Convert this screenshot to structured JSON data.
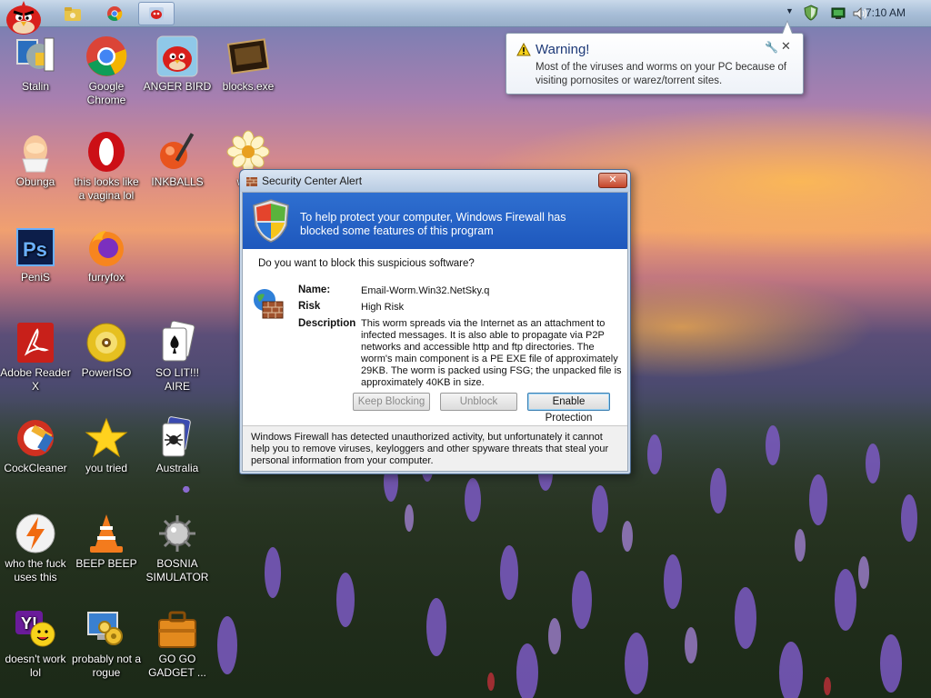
{
  "taskbar": {
    "clock": "7:10 AM"
  },
  "desktop_icons": [
    {
      "label": "Stalin",
      "icon": "stalin-icon"
    },
    {
      "label": "Google Chrome",
      "icon": "chrome-icon"
    },
    {
      "label": "ANGER BIRD",
      "icon": "angry-bird-icon"
    },
    {
      "label": "blocks.exe",
      "icon": "blocks-icon"
    },
    {
      "label": "Obunga",
      "icon": "egg-icon"
    },
    {
      "label": "this looks like a vagina lol",
      "icon": "opera-icon"
    },
    {
      "label": "INKBALLS",
      "icon": "inkballs-icon"
    },
    {
      "label": "winn",
      "icon": "flower-icon"
    },
    {
      "label": "PeniS",
      "icon": "photoshop-icon"
    },
    {
      "label": "furryfox",
      "icon": "firefox-icon"
    },
    {
      "label": "Adobe Reader X",
      "icon": "adobe-reader-icon"
    },
    {
      "label": "PowerISO",
      "icon": "poweriso-icon"
    },
    {
      "label": "SO LIT!!! AIRE",
      "icon": "solitaire-icon"
    },
    {
      "label": "CockCleaner",
      "icon": "ccleaner-icon"
    },
    {
      "label": "you tried",
      "icon": "star-icon"
    },
    {
      "label": "Australia",
      "icon": "spider-solitaire-icon"
    },
    {
      "label": "who the fuck uses this",
      "icon": "winamp-icon"
    },
    {
      "label": "BEEP BEEP",
      "icon": "vlc-icon"
    },
    {
      "label": "BOSNIA SIMULATOR",
      "icon": "minesweeper-icon"
    },
    {
      "label": "doesn't work lol",
      "icon": "yahoo-messenger-icon"
    },
    {
      "label": "probably not a rogue",
      "icon": "pc-gears-icon"
    },
    {
      "label": "GO GO GADGET ...",
      "icon": "gadget-briefcase-icon"
    }
  ],
  "balloon": {
    "title": "Warning!",
    "text": "Most of the viruses and worms on your PC because of visiting pornosites or warez/torrent sites."
  },
  "dialog": {
    "title": "Security Center Alert",
    "banner": "To help protect your computer, Windows Firewall has blocked some features of this program",
    "question": "Do you want to block this suspicious software?",
    "fields": {
      "name_label": "Name:",
      "name_value": "Email-Worm.Win32.NetSky.q",
      "risk_label": "Risk",
      "risk_value": "High Risk",
      "description_label": "Description",
      "description_value": "This worm spreads via the Internet as an attachment to infected messages. It is also able to propagate via P2P networks and accessible http and ftp directories. The worm's main component is a PE EXE file of approximately 29KB. The worm is packed using FSG; the unpacked file is approximately 40KB in size."
    },
    "buttons": {
      "keep_blocking": "Keep Blocking",
      "unblock": "Unblock",
      "enable_protection": "Enable Protection"
    },
    "footer": "Windows Firewall has detected unauthorized activity, but unfortunately it cannot help you to remove viruses, keyloggers and other spyware threats that steal your personal information from your computer."
  },
  "colors": {
    "banner_blue": "#1e58bd",
    "warning_title": "#1e3a78",
    "close_red": "#c4452a"
  }
}
